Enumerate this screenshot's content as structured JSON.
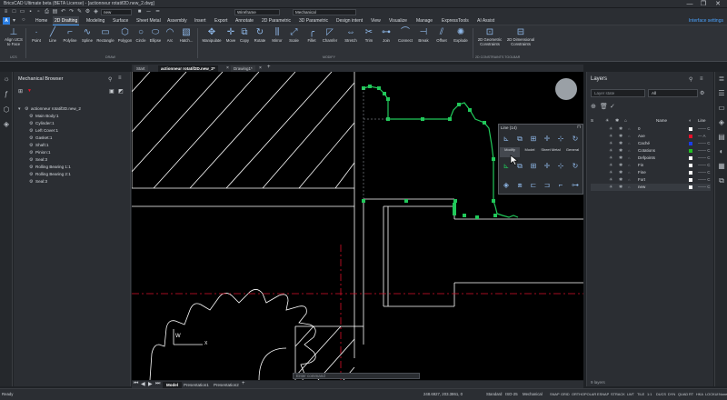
{
  "window": {
    "title": "BricsCAD Ultimate beta (BETA License) - [actionneur rotatif2D.new_2.dwg]",
    "min_glyph": "—",
    "max_glyph": "❐",
    "close_glyph": "✕"
  },
  "quick_access": {
    "workspace_value": "Wireframe",
    "profile_value": "Mechanical",
    "small_value": "new"
  },
  "menu": {
    "items": [
      "Home",
      "2D Drafting",
      "Modeling",
      "Surface",
      "Sheet Metal",
      "Assembly",
      "Insert",
      "Export",
      "Annotate",
      "2D Parametric",
      "3D Parametric",
      "Design intent",
      "View",
      "Visualize",
      "Manage",
      "ExpressTools",
      "AI Assist"
    ],
    "active": "2D Drafting",
    "interface_settings": "Interface settings"
  },
  "ribbon": {
    "ucs": {
      "label": "Align UCS to Face"
    },
    "draw": [
      "Point",
      "Line",
      "Polyline",
      "Spline",
      "Rectangle",
      "Polygon",
      "Circle",
      "Ellipse",
      "Arc",
      "Hatch..."
    ],
    "modify": [
      "Manipulate",
      "Move",
      "Copy",
      "Rotate",
      "Mirror",
      "Scale",
      "Fillet",
      "Chamfer",
      "Stretch",
      "Trim",
      "Join",
      "Connect",
      "Break",
      "Offset",
      "Explode"
    ],
    "constraints": [
      "2D Geometric Constraints",
      "2D Dimensional Constraints"
    ],
    "groups": [
      "UCS",
      "DRAW",
      "MODIFY",
      "2D CONSTRAINTS TOOLBAR"
    ]
  },
  "doc_tabs": [
    {
      "label": "Start"
    },
    {
      "label": "actionneur rotatif2D.new_2*"
    },
    {
      "label": "Drawing1*"
    }
  ],
  "mechanical_browser": {
    "title": "Mechanical Browser",
    "root": "actionneur rotatif2D.new_2",
    "components": [
      "Main Body:1",
      "Cylinder:1",
      "Left Cover:1",
      "Gasket:1",
      "Shaft:1",
      "Pinion:1",
      "Seal:3",
      "Rolling Bearing 1:1",
      "Rolling Bearing 2:1",
      "Seal:3"
    ]
  },
  "tool_palette": {
    "title": "Line (14)",
    "tabs": [
      "Modify",
      "Model",
      "Sheet Metal",
      "General",
      "Annotate"
    ],
    "active_tab": "Modify"
  },
  "canvas": {
    "ucs_w": "W",
    "ucs_x": "X"
  },
  "layers": {
    "title": "Layers",
    "search_placeholder": "Layer state",
    "filter_value": "All",
    "column_name": "Name",
    "column_linetype": "Line",
    "rows": [
      {
        "name": "0",
        "color": "#ffffff",
        "lt": "—— C"
      },
      {
        "name": "Axe",
        "color": "#e8102a",
        "lt": "— A"
      },
      {
        "name": "Caché",
        "color": "#1a3de8",
        "lt": "—— C"
      },
      {
        "name": "Cotations",
        "color": "#21c021",
        "lt": "—— C"
      },
      {
        "name": "Defpoints",
        "color": "#ffffff",
        "lt": "—— C"
      },
      {
        "name": "Fin",
        "color": "#ffffff",
        "lt": "—— C"
      },
      {
        "name": "Fine",
        "color": "#ffffff",
        "lt": "—— C"
      },
      {
        "name": "Fort",
        "color": "#ffffff",
        "lt": "—— C"
      },
      {
        "name": "new",
        "color": "#ffffff",
        "lt": "—— C"
      }
    ],
    "footer": "9 layers"
  },
  "command_line": {
    "placeholder": "Enter command"
  },
  "layout_tabs": [
    "Model",
    "Presentation1",
    "Presentation2"
  ],
  "status_bar": {
    "left_text": "Ready",
    "coords": "248.6927, 203.3861, 0",
    "standard": "Standard",
    "iso": "ISO-25",
    "profile": "Mechanical",
    "toggles": [
      "SNAP",
      "GRID",
      "ORTHO",
      "POLAR",
      "ESNAP",
      "STRACK",
      "LWT",
      "TILE",
      "1:1",
      "DUCS",
      "DYN",
      "QUAD",
      "RT",
      "HKA",
      "LOCKUI",
      "None"
    ]
  }
}
